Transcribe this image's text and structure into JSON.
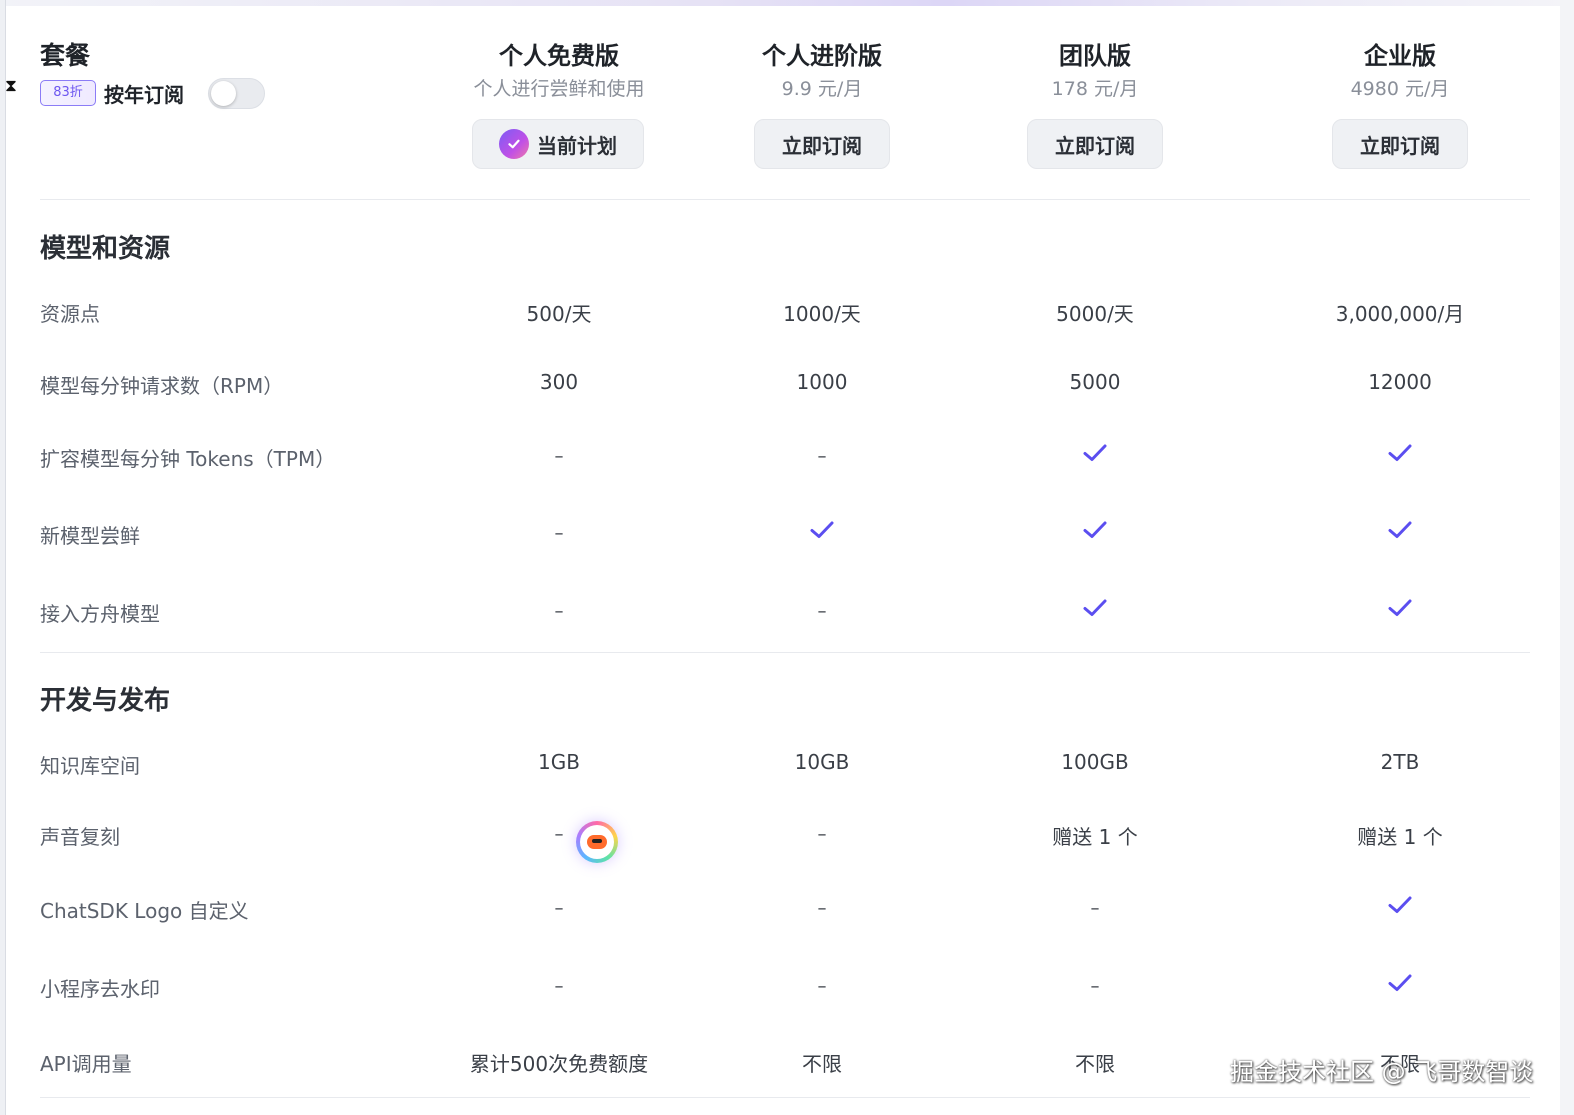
{
  "header": {
    "title": "套餐",
    "discount_badge": "83折",
    "yearly_label": "按年订阅",
    "yearly_toggle_on": false
  },
  "plans": [
    {
      "name": "个人免费版",
      "price": "个人进行尝鲜和使用",
      "button": "当前计划",
      "current": true
    },
    {
      "name": "个人进阶版",
      "price": "9.9 元/月",
      "button": "立即订阅",
      "current": false
    },
    {
      "name": "团队版",
      "price": "178 元/月",
      "button": "立即订阅",
      "current": false
    },
    {
      "name": "企业版",
      "price": "4980 元/月",
      "button": "立即订阅",
      "current": false
    }
  ],
  "sections": [
    {
      "title": "模型和资源",
      "rows": [
        {
          "label": "资源点",
          "values": [
            "500/天",
            "1000/天",
            "5000/天",
            "3,000,000/月"
          ]
        },
        {
          "label": "模型每分钟请求数（RPM）",
          "values": [
            "300",
            "1000",
            "5000",
            "12000"
          ]
        },
        {
          "label": "扩容模型每分钟 Tokens（TPM）",
          "values": [
            "–",
            "–",
            "check",
            "check"
          ]
        },
        {
          "label": "新模型尝鲜",
          "values": [
            "–",
            "check",
            "check",
            "check"
          ]
        },
        {
          "label": "接入方舟模型",
          "values": [
            "–",
            "–",
            "check",
            "check"
          ]
        }
      ]
    },
    {
      "title": "开发与发布",
      "rows": [
        {
          "label": "知识库空间",
          "values": [
            "1GB",
            "10GB",
            "100GB",
            "2TB"
          ]
        },
        {
          "label": "声音复刻",
          "values": [
            "–",
            "–",
            "赠送 1 个",
            "赠送 1 个"
          ]
        },
        {
          "label": "ChatSDK Logo 自定义",
          "values": [
            "–",
            "–",
            "–",
            "check"
          ]
        },
        {
          "label": "小程序去水印",
          "values": [
            "–",
            "–",
            "–",
            "check"
          ]
        },
        {
          "label": "API调用量",
          "values": [
            "累计500次免费额度",
            "不限",
            "不限",
            "不限"
          ]
        }
      ]
    }
  ],
  "watermark": "掘金技术社区 @ 飞哥数智谈",
  "colors": {
    "accent": "#5b4ef0",
    "check": "#5b4ef0",
    "label": "#5c626d",
    "button_bg": "#eff1f4"
  },
  "icons": {
    "check": "check-icon",
    "current_plan": "check-circle-icon",
    "assistant": "assistant-avatar-icon",
    "cursor": "hourglass-cursor-icon"
  }
}
